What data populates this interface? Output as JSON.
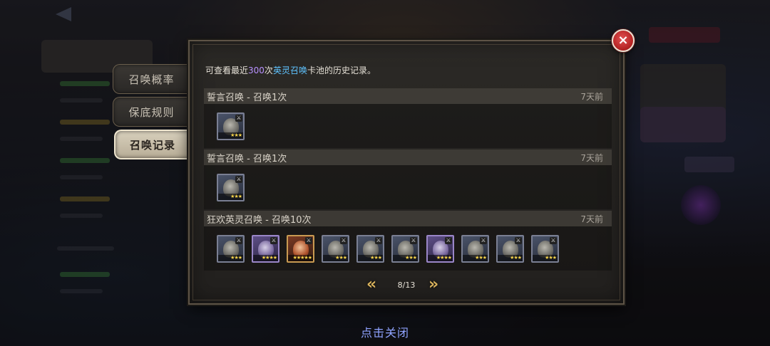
{
  "tabs": [
    {
      "label": "召唤概率",
      "active": false
    },
    {
      "label": "保底规则",
      "active": false
    },
    {
      "label": "召唤记录",
      "active": true
    }
  ],
  "panel": {
    "note_prefix": "可查看最近",
    "note_count": "300",
    "note_mid": "次",
    "note_pool": "英灵召唤",
    "note_suffix": "卡池的历史记录。"
  },
  "records": [
    {
      "title": "誓言召唤 - 召唤1次",
      "time": "7天前",
      "heroes": [
        {
          "rarity": "blue",
          "stars": "★★★"
        }
      ]
    },
    {
      "title": "誓言召唤 - 召唤1次",
      "time": "7天前",
      "heroes": [
        {
          "rarity": "blue",
          "stars": "★★★"
        }
      ]
    },
    {
      "title": "狂欢英灵召唤 - 召唤10次",
      "time": "7天前",
      "heroes": [
        {
          "rarity": "blue",
          "stars": "★★★"
        },
        {
          "rarity": "purple",
          "stars": "★★★★"
        },
        {
          "rarity": "gold",
          "stars": "★★★★★"
        },
        {
          "rarity": "blue",
          "stars": "★★★"
        },
        {
          "rarity": "blue",
          "stars": "★★★"
        },
        {
          "rarity": "blue",
          "stars": "★★★"
        },
        {
          "rarity": "purple",
          "stars": "★★★★"
        },
        {
          "rarity": "blue",
          "stars": "★★★"
        },
        {
          "rarity": "blue",
          "stars": "★★★"
        },
        {
          "rarity": "blue",
          "stars": "★★★"
        }
      ]
    }
  ],
  "pagination": {
    "page": "8/13",
    "prev": "«",
    "next": "»"
  },
  "close_icon": "×",
  "close_hint": "点击关闭",
  "colors": {
    "count": "#b891ff",
    "pool": "#5fc3ff",
    "hint": "#8fa3ff",
    "close": "#c42a2a"
  }
}
